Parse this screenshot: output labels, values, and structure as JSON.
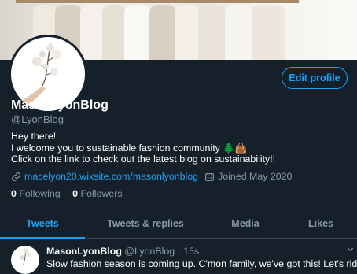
{
  "profile": {
    "name": "MasonLyonBlog",
    "handle": "@LyonBlog",
    "edit_label": "Edit profile",
    "bio_line1": "Hey there!",
    "bio_line2": "I welcome you to sustainable fashion community 🌲👜",
    "bio_line3": "Click on the link to check out the latest blog on sustainability!!",
    "website": "macelyon20.wixsite.com/masonlyonblog",
    "joined": "Joined May 2020",
    "following_count": "0",
    "following_label": "Following",
    "followers_count": "0",
    "followers_label": "Followers"
  },
  "tabs": [
    {
      "label": "Tweets",
      "active": true
    },
    {
      "label": "Tweets & replies",
      "active": false
    },
    {
      "label": "Media",
      "active": false
    },
    {
      "label": "Likes",
      "active": false
    }
  ],
  "tweet": {
    "author": "MasonLyonBlog",
    "handle": "@LyonBlog",
    "separator": "·",
    "time": "15s",
    "text": "Slow fashion season is coming up. C'mon family, we've got this! Let's ride"
  },
  "colors": {
    "background": "#15202b",
    "accent": "#1da1f2",
    "secondary_text": "#8899a6"
  }
}
